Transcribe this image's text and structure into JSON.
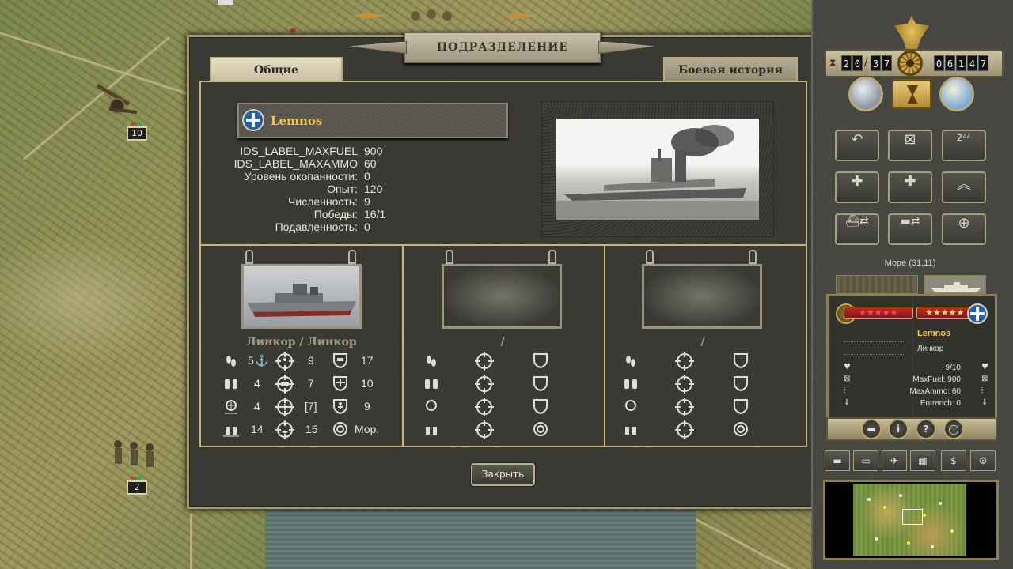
{
  "map": {
    "badges": [
      "10",
      "2"
    ]
  },
  "dialog": {
    "title": "ПОДРАЗДЕЛЕНИЕ",
    "tabs": {
      "general": "Общие",
      "history": "Боевая история"
    },
    "unit_name": "Lemnos",
    "stats": [
      {
        "label": "IDS_LABEL_MAXFUEL",
        "value": "900"
      },
      {
        "label": "IDS_LABEL_MAXAMMO",
        "value": "60"
      },
      {
        "label": "Уровень окопанности:",
        "value": "0"
      },
      {
        "label": "Опыт:",
        "value": "120"
      },
      {
        "label": "Численность:",
        "value": "9"
      },
      {
        "label": "Победы:",
        "value": "16/1"
      },
      {
        "label": "Подавленность:",
        "value": "0"
      }
    ],
    "slots": [
      {
        "type": "Линкор / Линкор",
        "values": {
          "move": "5",
          "spot": "4",
          "range": "4",
          "transport": "14",
          "soft_attack": "9",
          "hard_attack": "7",
          "air_attack": "[7]",
          "naval_attack": "15",
          "ground_def": "17",
          "air_def": "10",
          "close_def": "9",
          "target": "Мор."
        }
      },
      {
        "type": "/",
        "values": {}
      },
      {
        "type": "/",
        "values": {}
      }
    ],
    "close_label": "Закрыть"
  },
  "panel": {
    "turn_current": [
      "2",
      "0"
    ],
    "turn_total": [
      "3",
      "7"
    ],
    "prestige": [
      "0",
      "6",
      "1",
      "4",
      "7"
    ],
    "hex_label": "Море (31,11)",
    "unit_name": "Lemnos",
    "unit_type": "Линкор",
    "strength": "9/10",
    "max_fuel": "MaxFuel: 900",
    "max_ammo": "MaxAmmo: 60",
    "entrench": "Entrench: 0",
    "commands": [
      "undo-icon",
      "disband-icon",
      "sleep-icon",
      "reinforce-icon",
      "elite-reinforce-icon",
      "upgrade-icon",
      "embark-sea-icon",
      "embark-land-icon",
      "air-mission-icon"
    ],
    "colors": {
      "accent": "#f3c648",
      "frame": "#c9b47a"
    }
  }
}
